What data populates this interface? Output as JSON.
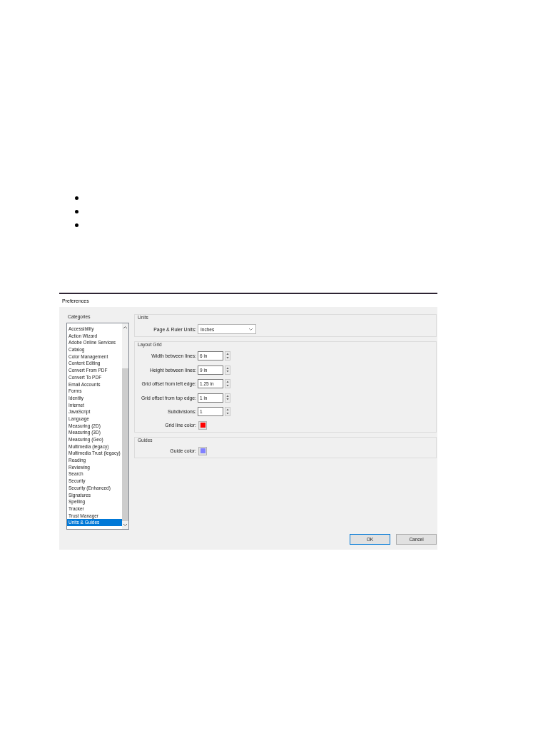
{
  "bullets": [
    {
      "kind": "dot"
    },
    {
      "kind": "dot"
    },
    {
      "kind": "dot"
    }
  ],
  "dialog": {
    "title": "Preferences",
    "categories": {
      "label": "Categories",
      "items": [
        {
          "label": "Accessibility",
          "selected": false
        },
        {
          "label": "Action Wizard",
          "selected": false
        },
        {
          "label": "Adobe Online Services",
          "selected": false
        },
        {
          "label": "Catalog",
          "selected": false
        },
        {
          "label": "Color Management",
          "selected": false
        },
        {
          "label": "Content Editing",
          "selected": false
        },
        {
          "label": "Convert From PDF",
          "selected": false
        },
        {
          "label": "Convert To PDF",
          "selected": false
        },
        {
          "label": "Email Accounts",
          "selected": false
        },
        {
          "label": "Forms",
          "selected": false
        },
        {
          "label": "Identity",
          "selected": false
        },
        {
          "label": "Internet",
          "selected": false
        },
        {
          "label": "JavaScript",
          "selected": false
        },
        {
          "label": "Language",
          "selected": false
        },
        {
          "label": "Measuring (2D)",
          "selected": false
        },
        {
          "label": "Measuring (3D)",
          "selected": false
        },
        {
          "label": "Measuring (Geo)",
          "selected": false
        },
        {
          "label": "Multimedia (legacy)",
          "selected": false
        },
        {
          "label": "Multimedia Trust (legacy)",
          "selected": false
        },
        {
          "label": "Reading",
          "selected": false
        },
        {
          "label": "Reviewing",
          "selected": false
        },
        {
          "label": "Search",
          "selected": false
        },
        {
          "label": "Security",
          "selected": false
        },
        {
          "label": "Security (Enhanced)",
          "selected": false
        },
        {
          "label": "Signatures",
          "selected": false
        },
        {
          "label": "Spelling",
          "selected": false
        },
        {
          "label": "Tracker",
          "selected": false
        },
        {
          "label": "Trust Manager",
          "selected": false
        },
        {
          "label": "Units & Guides",
          "selected": true
        }
      ]
    },
    "sections": [
      {
        "title": "Units",
        "rows": [
          {
            "kind": "dropdown",
            "label": "Page & Ruler Units:",
            "value": "Inches"
          }
        ]
      },
      {
        "title": "Layout Grid",
        "rows": [
          {
            "kind": "spinner",
            "label": "Width between lines:",
            "value": "6 in"
          },
          {
            "kind": "spinner",
            "label": "Height between lines:",
            "value": "9 in"
          },
          {
            "kind": "spinner",
            "label": "Grid offset from left edge:",
            "value": "1.25 in"
          },
          {
            "kind": "spinner",
            "label": "Grid offset from top edge:",
            "value": "1 in"
          },
          {
            "kind": "spinner",
            "label": "Subdivisions:",
            "value": "1"
          },
          {
            "kind": "color",
            "label": "Grid line color:",
            "color": "#ff0000"
          }
        ]
      },
      {
        "title": "Guides",
        "rows": [
          {
            "kind": "color",
            "label": "Guide color:",
            "color": "#8080ff"
          }
        ]
      }
    ],
    "buttons": [
      {
        "label": "OK",
        "default": true
      },
      {
        "label": "Cancel",
        "default": false
      }
    ]
  }
}
